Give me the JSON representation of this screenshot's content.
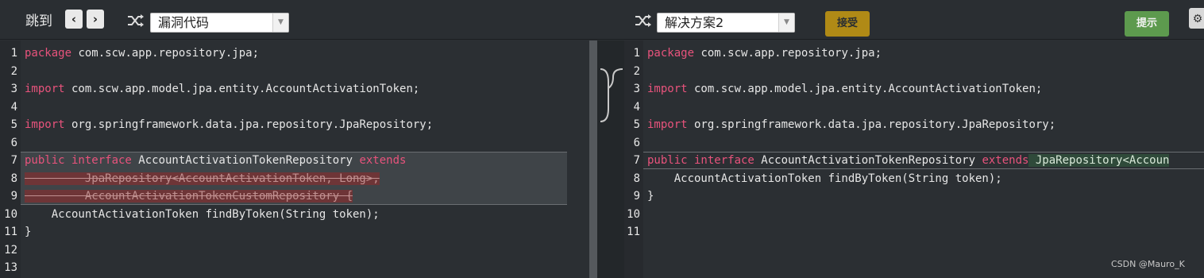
{
  "toolbar": {
    "jump_label": "跳到",
    "prev_icon": "chevron-left-icon",
    "next_icon": "chevron-right-icon",
    "left_select": "漏洞代码",
    "right_select": "解决方案2",
    "accept_label": "接受",
    "hint_label": "提示",
    "accept_color": "#b08a16",
    "hint_color": "#5d9a4e"
  },
  "left_pane": {
    "line_numbers": [
      "1",
      "2",
      "3",
      "4",
      "5",
      "6",
      "7",
      "8",
      "9",
      "10",
      "11",
      "12",
      "13"
    ],
    "lines": [
      {
        "kw": "package",
        "text": " com.scw.app.repository.jpa;"
      },
      {
        "kw": "",
        "text": ""
      },
      {
        "kw": "import",
        "text": " com.scw.app.model.jpa.entity.AccountActivationToken;"
      },
      {
        "kw": "",
        "text": ""
      },
      {
        "kw": "import",
        "text": " org.springframework.data.jpa.repository.JpaRepository;"
      },
      {
        "kw": "",
        "text": ""
      },
      {
        "kw": "public interface",
        "text": " AccountActivationTokenRepository ",
        "kw2": "extends"
      },
      {
        "del": "         JpaRepository<AccountActivationToken, Long>,"
      },
      {
        "del": "         AccountActivationTokenCustomRepository {"
      },
      {
        "kw": "",
        "text": "    AccountActivationToken findByToken(String token);"
      },
      {
        "kw": "",
        "text": "}"
      }
    ]
  },
  "right_pane": {
    "line_numbers": [
      "1",
      "2",
      "3",
      "4",
      "5",
      "6",
      "7",
      "8",
      "9",
      "10",
      "11"
    ],
    "lines": [
      {
        "kw": "package",
        "text": " com.scw.app.repository.jpa;"
      },
      {
        "kw": "",
        "text": ""
      },
      {
        "kw": "import",
        "text": " com.scw.app.model.jpa.entity.AccountActivationToken;"
      },
      {
        "kw": "",
        "text": ""
      },
      {
        "kw": "import",
        "text": " org.springframework.data.jpa.repository.JpaRepository;"
      },
      {
        "kw": "",
        "text": ""
      },
      {
        "kw": "public interface",
        "text": " AccountActivationTokenRepository ",
        "kw2": "extends",
        "add": " JpaRepository<Accoun"
      },
      {
        "kw": "",
        "text": "    AccountActivationToken findByToken(String token);"
      },
      {
        "kw": "",
        "text": "}"
      }
    ]
  },
  "watermark": "CSDN @Mauro_K"
}
